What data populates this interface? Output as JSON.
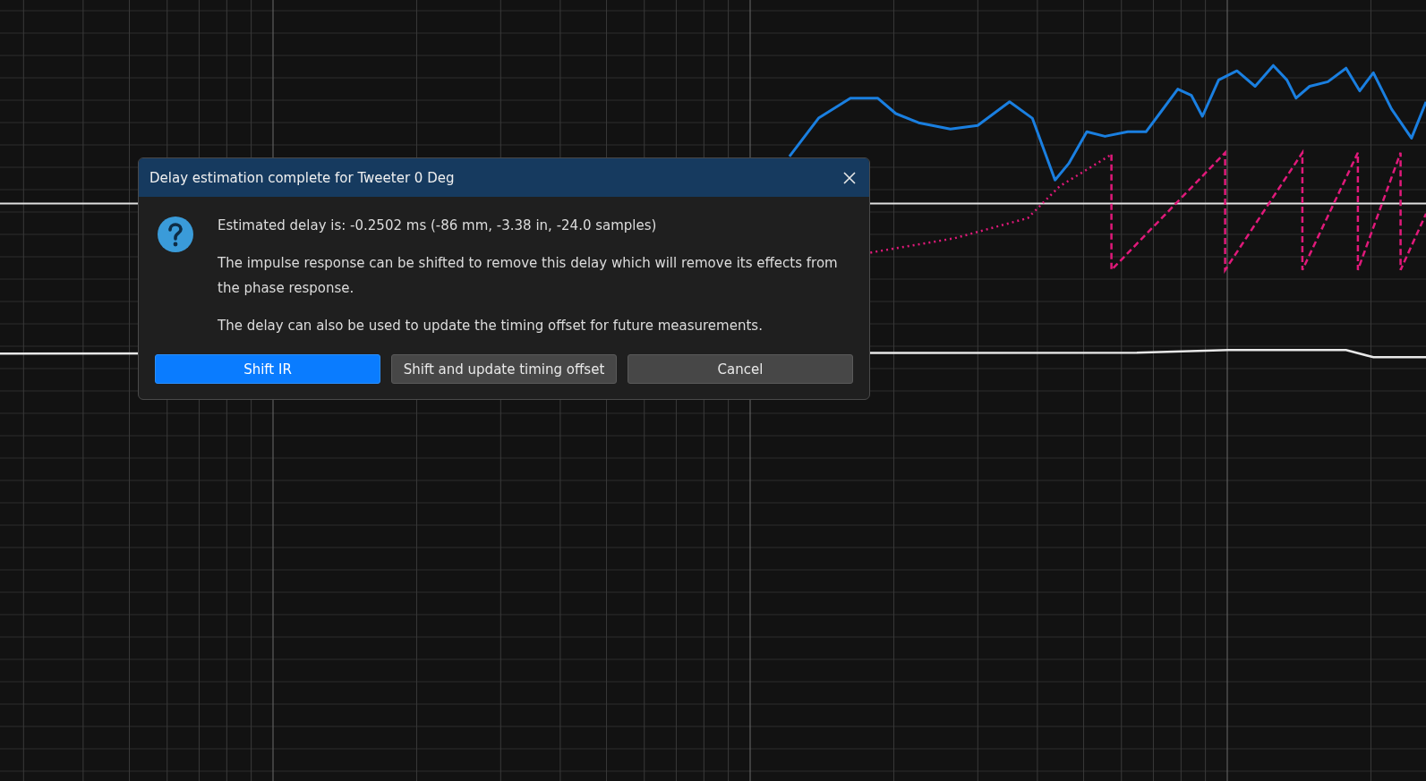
{
  "dialog": {
    "title": "Delay estimation complete for Tweeter 0 Deg",
    "paragraphs": [
      "Estimated delay is: -0.2502 ms (-86 mm, -3.38 in, -24.0 samples)",
      "The impulse response can be shifted to remove this delay which will remove its effects from the phase response.",
      "The delay can also be used to update the timing offset for future measurements."
    ],
    "buttons": [
      {
        "label": "Shift IR",
        "default": true
      },
      {
        "label": "Shift and update timing offset",
        "default": false
      },
      {
        "label": "Cancel",
        "default": false
      }
    ]
  }
}
